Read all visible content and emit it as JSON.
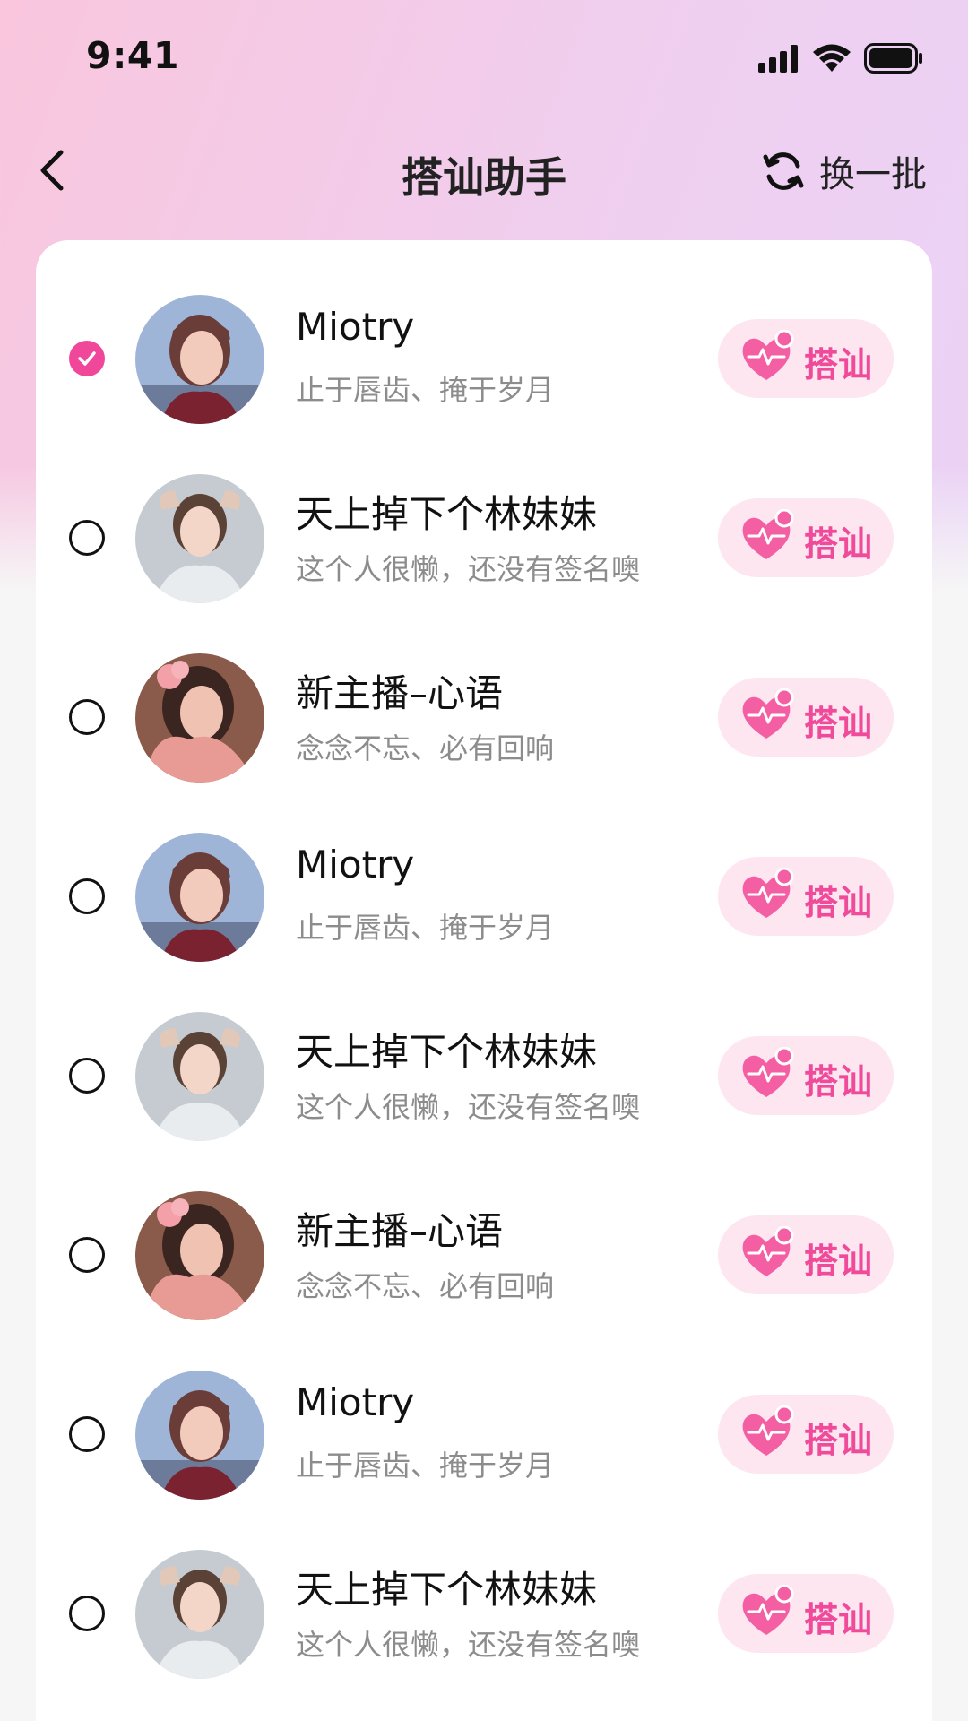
{
  "status_bar": {
    "time": "9:41"
  },
  "header": {
    "title": "搭讪助手",
    "refresh_label": "换一批"
  },
  "colors": {
    "accent": "#f0479b",
    "button_bg": "#fde6f0",
    "subtitle": "#8c8c8c"
  },
  "users": [
    {
      "name": "Miotry",
      "signature": "止于唇齿、掩于岁月",
      "selected": true,
      "avatar": "avatar-red-top",
      "button_label": "搭讪"
    },
    {
      "name": "天上掉下个林妹妹",
      "signature": "这个人很懒，还没有签名噢",
      "selected": false,
      "avatar": "avatar-grey-top",
      "button_label": "搭讪"
    },
    {
      "name": "新主播–心语",
      "signature": "念念不忘、必有回响",
      "selected": false,
      "avatar": "avatar-pink-sweater",
      "button_label": "搭讪"
    },
    {
      "name": "Miotry",
      "signature": "止于唇齿、掩于岁月",
      "selected": false,
      "avatar": "avatar-red-top",
      "button_label": "搭讪"
    },
    {
      "name": "天上掉下个林妹妹",
      "signature": "这个人很懒，还没有签名噢",
      "selected": false,
      "avatar": "avatar-grey-top",
      "button_label": "搭讪"
    },
    {
      "name": "新主播–心语",
      "signature": "念念不忘、必有回响",
      "selected": false,
      "avatar": "avatar-pink-sweater",
      "button_label": "搭讪"
    },
    {
      "name": "Miotry",
      "signature": "止于唇齿、掩于岁月",
      "selected": false,
      "avatar": "avatar-red-top",
      "button_label": "搭讪"
    },
    {
      "name": "天上掉下个林妹妹",
      "signature": "这个人很懒，还没有签名噢",
      "selected": false,
      "avatar": "avatar-grey-top",
      "button_label": "搭讪"
    }
  ]
}
